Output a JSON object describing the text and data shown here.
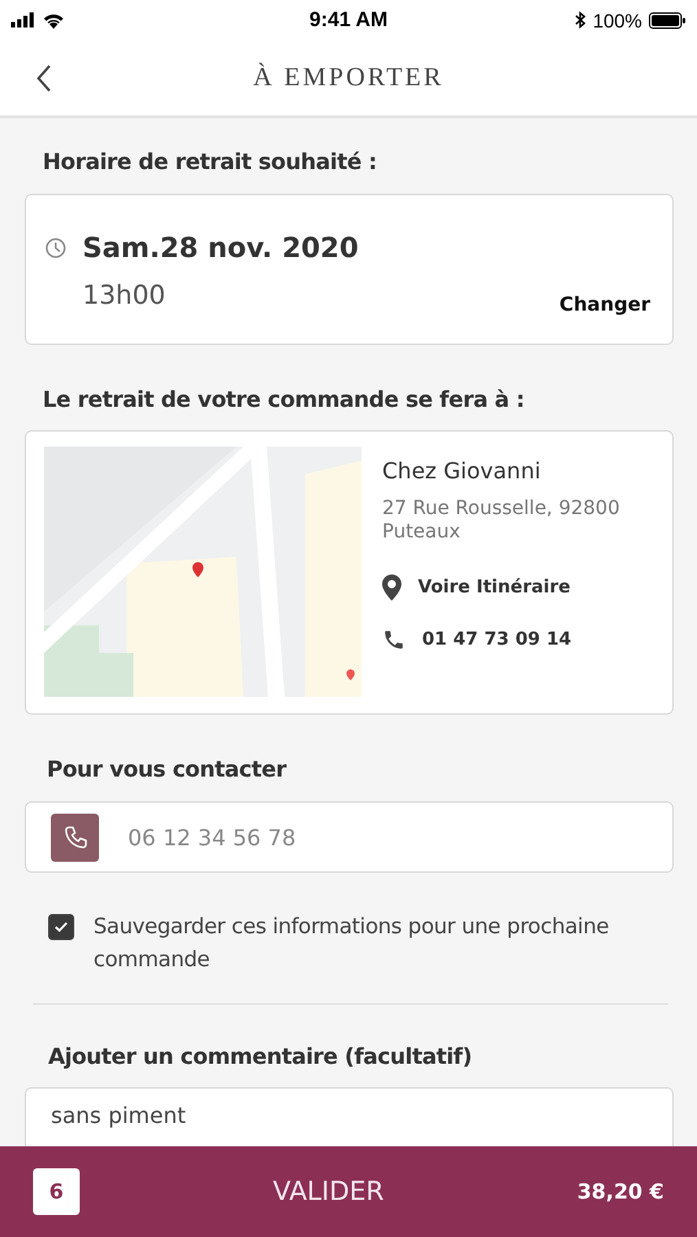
{
  "status_bar": {
    "time": "9:41 AM",
    "battery": "100%"
  },
  "header": {
    "title": "À EMPORTER"
  },
  "pickup_time": {
    "label": "Horaire de retrait souhaité :",
    "date": "Sam.28 nov. 2020",
    "time": "13h00",
    "change": "Changer"
  },
  "pickup_place": {
    "label": "Le retrait de votre commande se fera à :",
    "name": "Chez Giovanni",
    "address": "27 Rue Rousselle, 92800 Puteaux",
    "directions": "Voire Itinéraire",
    "phone": "01 47 73 09 14"
  },
  "contact": {
    "label": "Pour vous contacter",
    "phone_field": {
      "placeholder": "06 12 34 56 78"
    },
    "save": {
      "label": "Sauvegarder ces informations pour une prochaine commande",
      "checked": true
    }
  },
  "comment": {
    "label": "Ajouter un commentaire (facultatif)",
    "value": "sans piment"
  },
  "footer": {
    "count": "6",
    "action": "VALIDER",
    "total": "38,20 €"
  }
}
